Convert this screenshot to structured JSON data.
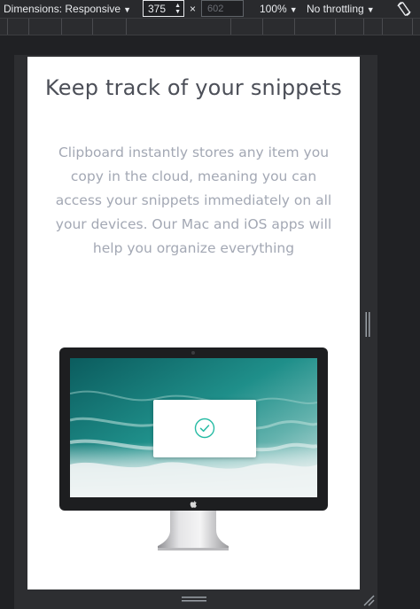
{
  "toolbar": {
    "dimensions_label": "Dimensions: Responsive",
    "width_value": "375",
    "times_symbol": "×",
    "height_value": "602",
    "zoom_label": "100%",
    "throttling_label": "No throttling"
  },
  "icons": {
    "dropdown": "caret-down-icon",
    "spinner": "spin-arrows-icon",
    "rotate": "rotate-device-icon",
    "success": "check-circle-icon",
    "apple": "apple-icon"
  },
  "page": {
    "headline": "Keep track of your snippets",
    "body": "Clipboard instantly stores any item you copy in the cloud, meaning you can access your snippets immediately on all your devices. Our Mac and iOS apps will help you organize everything"
  },
  "colors": {
    "accent": "#26bba4",
    "headline": "#4c4f58",
    "body_text": "#a3a8b4"
  }
}
